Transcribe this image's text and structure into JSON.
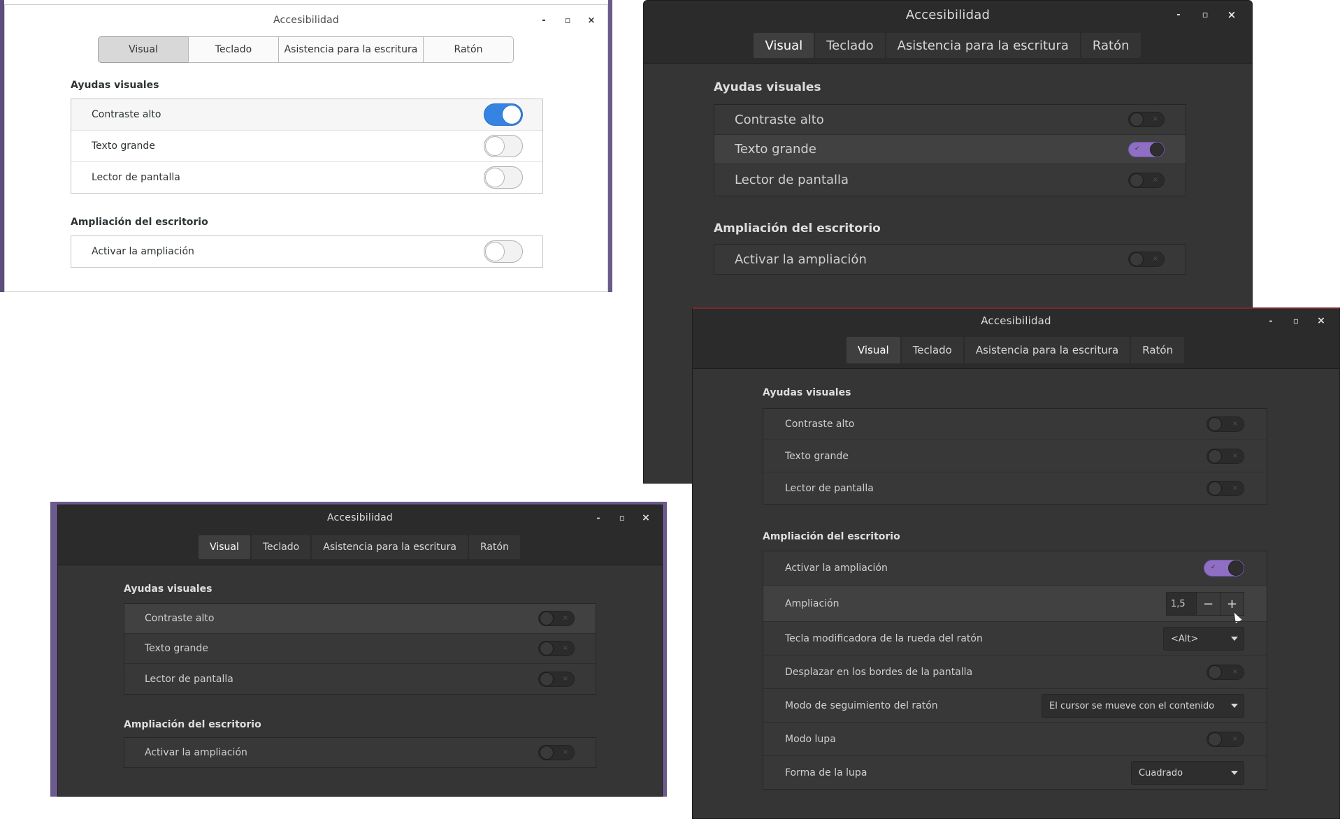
{
  "app_title": "Accesibilidad",
  "window_controls": {
    "minimize": "-",
    "maximize": "▫",
    "close": "×"
  },
  "tabs": [
    "Visual",
    "Teclado",
    "Asistencia para la escritura",
    "Ratón"
  ],
  "sections": {
    "visual_aids": "Ayudas visuales",
    "zoom": "Ampliación del escritorio"
  },
  "rows": {
    "high_contrast": "Contraste alto",
    "large_text": "Texto grande",
    "screen_reader": "Lector de pantalla",
    "enable_zoom": "Activar la ampliación",
    "magnification": "Ampliación",
    "mouse_wheel_modifier": "Tecla modificadora de la rueda del ratón",
    "screen_edge_scroll": "Desplazar en los bordes de la pantalla",
    "mouse_tracking": "Modo de seguimiento del ratón",
    "lens_mode": "Modo lupa",
    "lens_shape": "Forma de la lupa"
  },
  "windows": [
    {
      "theme": "light",
      "toggles": {
        "high_contrast": true,
        "large_text": false,
        "screen_reader": false,
        "enable_zoom": false
      }
    },
    {
      "theme": "dark-purple",
      "toggles": {
        "high_contrast": false,
        "large_text": true,
        "screen_reader": false,
        "enable_zoom": false
      }
    },
    {
      "theme": "dark",
      "toggles": {
        "high_contrast": false,
        "large_text": false,
        "screen_reader": false,
        "enable_zoom": false
      }
    },
    {
      "theme": "dark-purple",
      "toggles": {
        "high_contrast": false,
        "large_text": false,
        "screen_reader": false,
        "enable_zoom": true,
        "screen_edge_scroll": false,
        "lens_mode": false
      },
      "magnification_value": "1,5",
      "spin_minus": "−",
      "spin_plus": "+",
      "mouse_wheel_modifier_value": "<Alt>",
      "mouse_tracking_value": "El cursor se mueve con el contenido",
      "lens_shape_value": "Cuadrado"
    }
  ],
  "colors": {
    "accent_blue": "#3584e4",
    "accent_purple": "#8e6fc4",
    "dark_bg": "#353535",
    "header_bg": "#2b2b2b"
  }
}
